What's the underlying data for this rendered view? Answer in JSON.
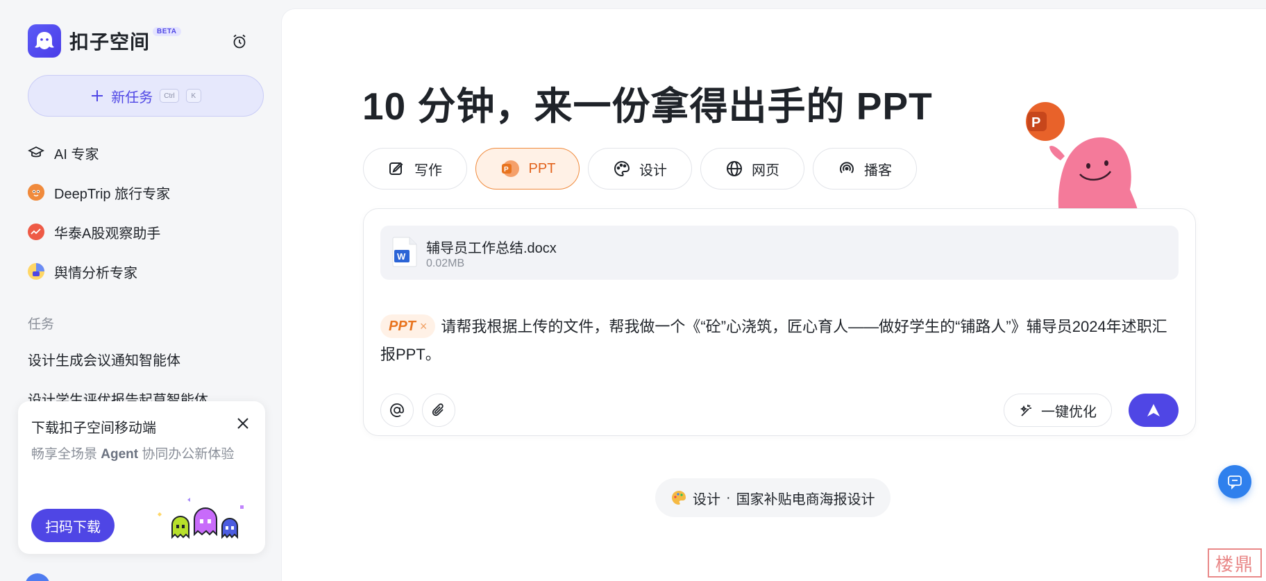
{
  "app": {
    "name": "扣子空间",
    "badge": "BETA"
  },
  "sidebar": {
    "new_task": {
      "label": "新任务",
      "shortcut": [
        "Ctrl",
        "K"
      ]
    },
    "experts": [
      {
        "label": "AI 专家",
        "icon": "graduation-cap-icon"
      },
      {
        "label": "DeepTrip 旅行专家",
        "icon": "deeptrip-avatar"
      },
      {
        "label": "华泰A股观察助手",
        "icon": "huatai-avatar"
      },
      {
        "label": "舆情分析专家",
        "icon": "sentiment-avatar"
      }
    ],
    "tasks_section": "任务",
    "tasks": [
      "设计生成会议通知智能体",
      "设计学生评优报告起草智能体"
    ],
    "promo": {
      "title": "下载扣子空间移动端",
      "desc_prefix": "畅享全场景 ",
      "desc_bold": "Agent",
      "desc_suffix": " 协同办公新体验",
      "button": "扫码下载"
    }
  },
  "main": {
    "headline": "10 分钟，来一份拿得出手的 PPT",
    "tabs": [
      {
        "label": "写作",
        "icon": "writing-icon",
        "active": false
      },
      {
        "label": "PPT",
        "icon": "ppt-icon",
        "active": true
      },
      {
        "label": "设计",
        "icon": "palette-icon",
        "active": false
      },
      {
        "label": "网页",
        "icon": "globe-icon",
        "active": false
      },
      {
        "label": "播客",
        "icon": "podcast-icon",
        "active": false
      }
    ],
    "attachment": {
      "name": "辅导员工作总结.docx",
      "size": "0.02MB"
    },
    "prompt": {
      "chip": "PPT",
      "text": "请帮我根据上传的文件，帮我做一个《“砼”心浇筑，匠心育人——做好学生的“铺路人”》辅导员2024年述职汇报PPT。"
    },
    "optimize": "一键优化",
    "suggestion": {
      "category": "设计",
      "separator": "·",
      "title": "国家补贴电商海报设计"
    }
  },
  "watermark": "楼鼎",
  "colors": {
    "accent": "#4f46e5",
    "ppt_orange": "#e8741f",
    "chat_blue": "#2f80ed"
  }
}
